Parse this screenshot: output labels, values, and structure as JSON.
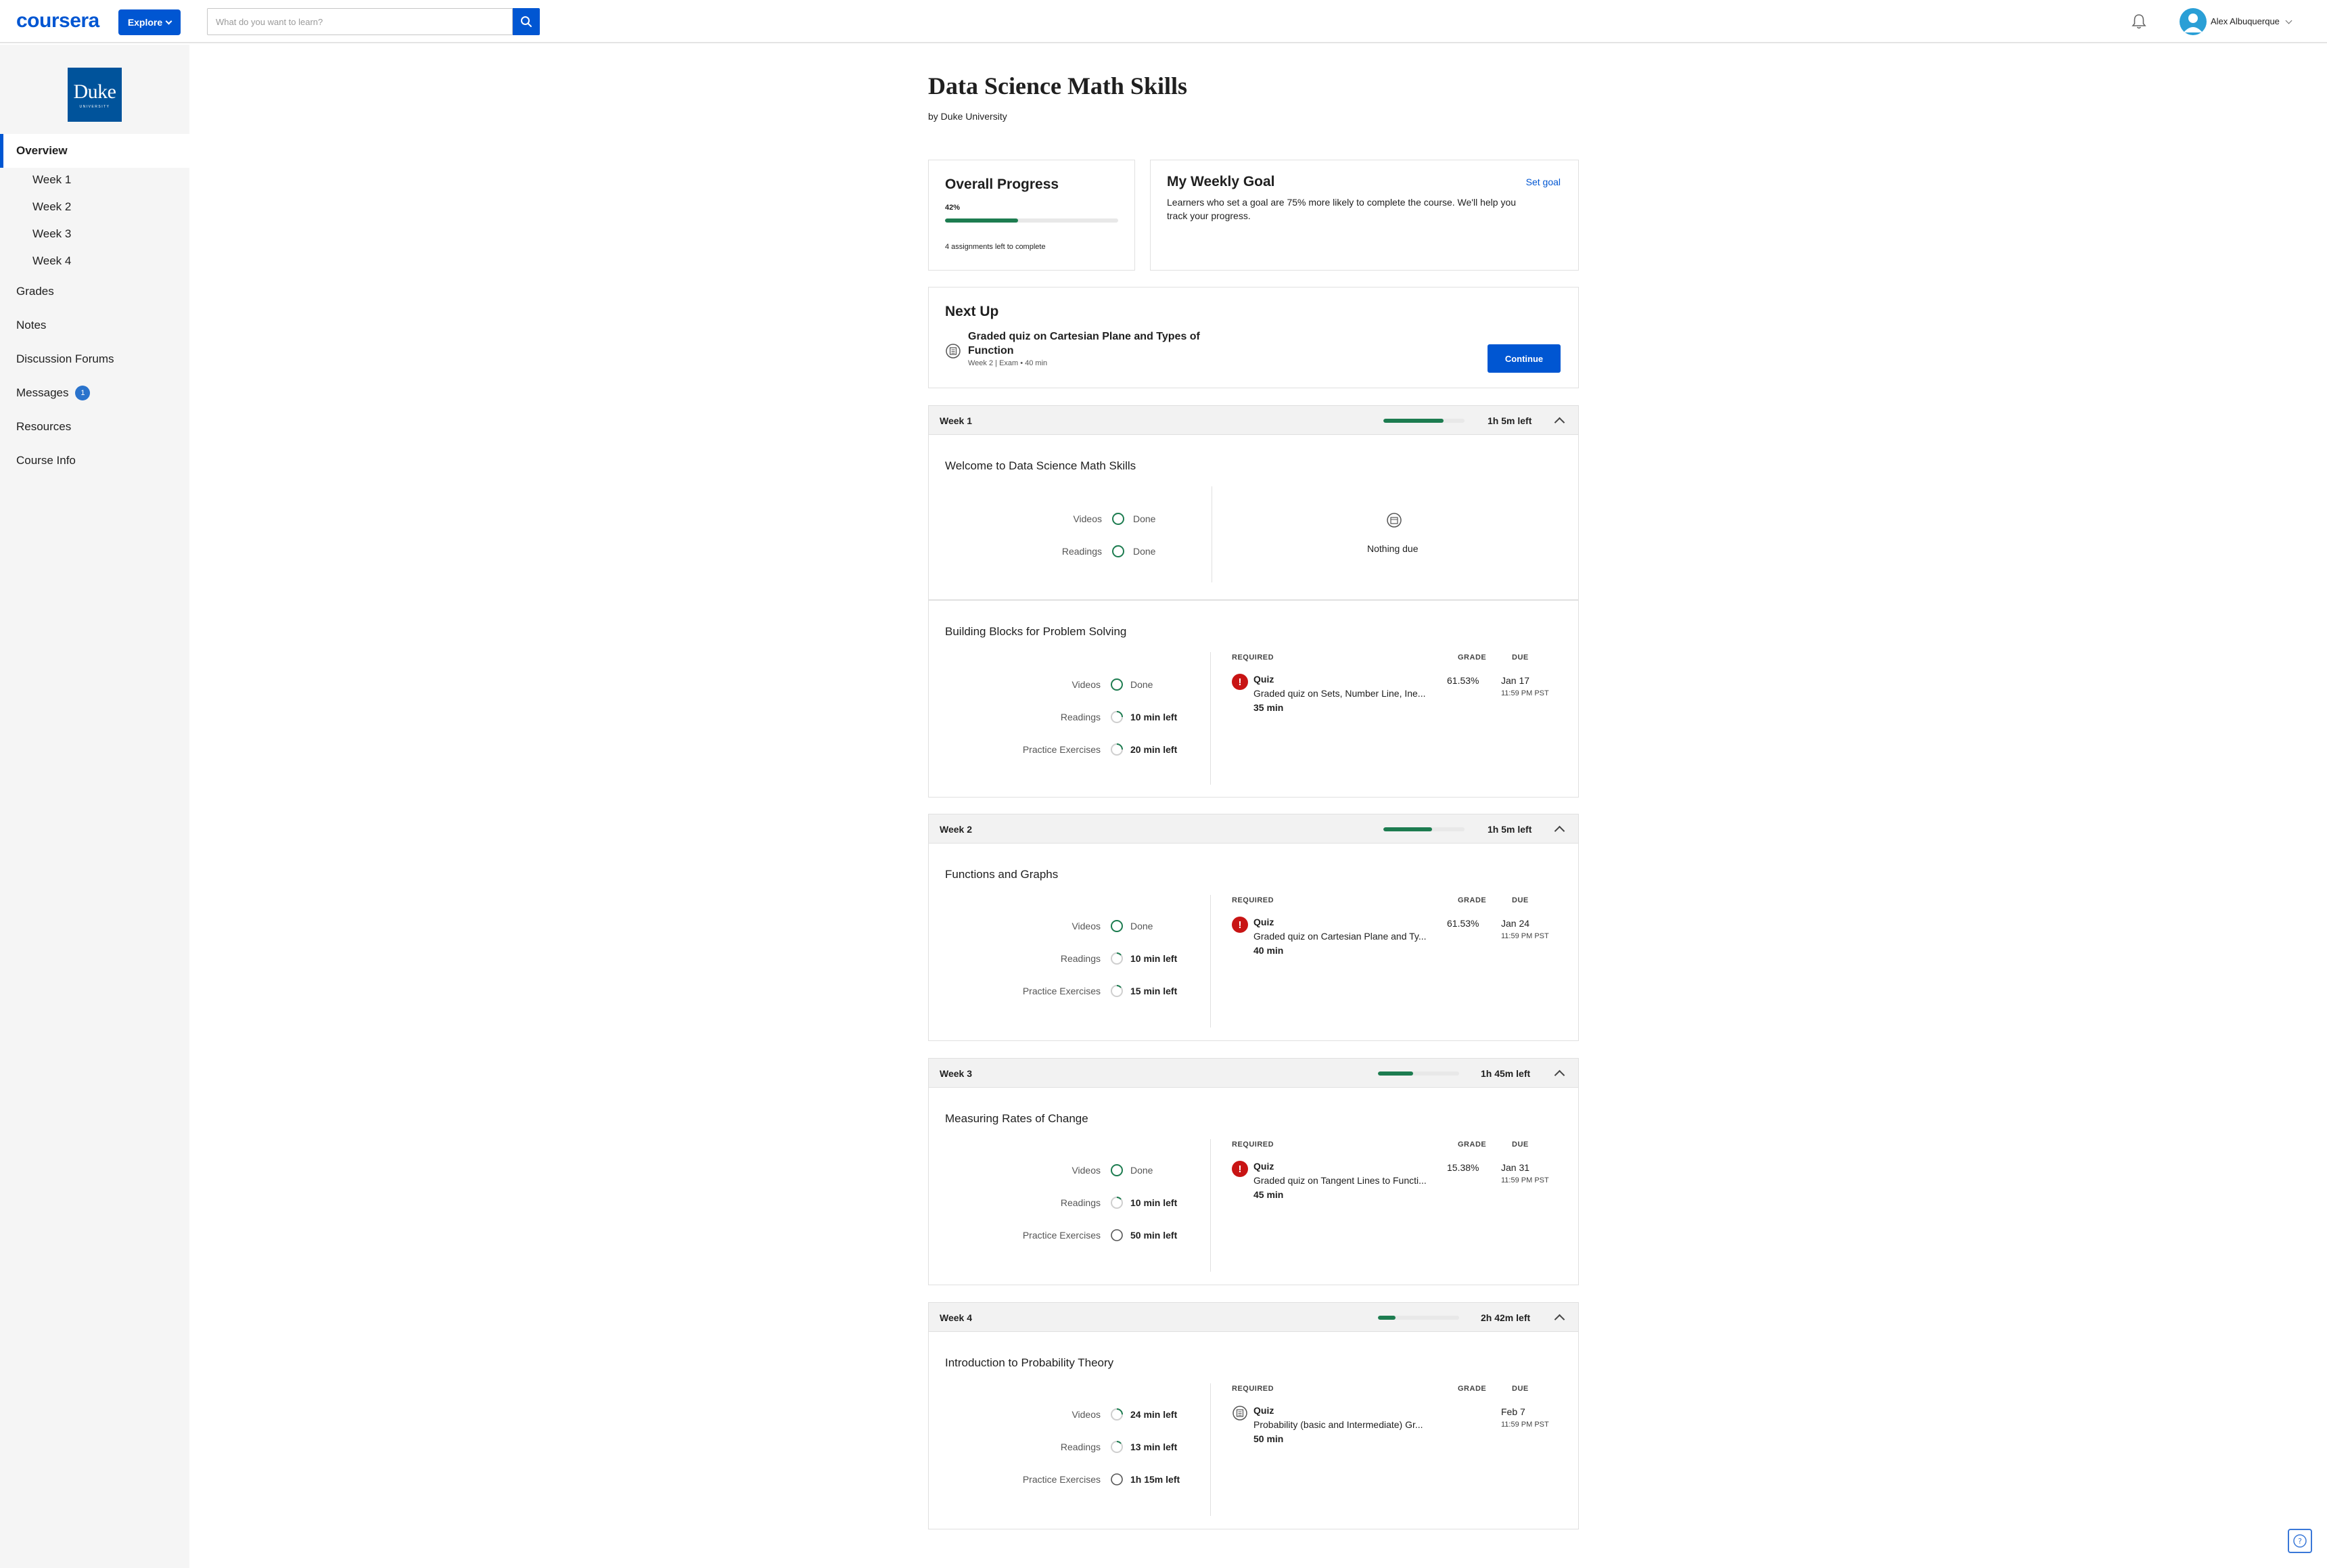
{
  "header": {
    "logo": "coursera",
    "explore_label": "Explore",
    "search_placeholder": "What do you want to learn?",
    "user_name": "Alex Albuquerque"
  },
  "sidebar": {
    "university_logo_text": "Duke",
    "university_logo_sub": "UNIVERSITY",
    "items": [
      {
        "label": "Overview",
        "active": true
      },
      {
        "label": "Week 1"
      },
      {
        "label": "Week 2"
      },
      {
        "label": "Week 3"
      },
      {
        "label": "Week 4"
      },
      {
        "label": "Grades"
      },
      {
        "label": "Notes"
      },
      {
        "label": "Discussion Forums"
      },
      {
        "label": "Messages",
        "badge": "1"
      },
      {
        "label": "Resources"
      },
      {
        "label": "Course Info"
      }
    ]
  },
  "course": {
    "title": "Data Science Math Skills",
    "org": "by Duke University"
  },
  "overall_progress": {
    "title": "Overall Progress",
    "percent_label": "42%",
    "percent": 42,
    "assignments_left": "4 assignments left to complete"
  },
  "weekly_goal": {
    "title": "My Weekly Goal",
    "set_goal": "Set goal",
    "description": "Learners who set a goal are 75% more likely to complete the course. We'll help you track your progress."
  },
  "next_up": {
    "title": "Next Up",
    "item_title": "Graded quiz on Cartesian Plane and Types of Function",
    "item_meta": "Week 2 | Exam • 40 min",
    "continue_label": "Continue"
  },
  "labels": {
    "videos": "Videos",
    "readings": "Readings",
    "practice": "Practice Exercises",
    "done": "Done",
    "required": "REQUIRED",
    "grade": "GRADE",
    "due": "DUE",
    "quiz": "Quiz",
    "nothing_due": "Nothing due"
  },
  "weeks": [
    {
      "title": "Week 1",
      "time_left": "1h 5m left",
      "progress": 74,
      "modules": [
        {
          "title": "Welcome to Data Science Math Skills",
          "videos": "Done",
          "readings": "Done"
        },
        {
          "title": "Building Blocks for Problem Solving",
          "videos": "Done",
          "readings": "10 min left",
          "practice": "20 min left",
          "quiz": {
            "name": "Graded quiz on Sets, Number Line, Ine...",
            "duration": "35 min",
            "grade": "61.53%",
            "due_date": "Jan 17",
            "due_time": "11:59 PM PST"
          }
        }
      ]
    },
    {
      "title": "Week 2",
      "time_left": "1h 5m left",
      "progress": 60,
      "modules": [
        {
          "title": "Functions and Graphs",
          "videos": "Done",
          "readings": "10 min left",
          "practice": "15 min left",
          "quiz": {
            "name": "Graded quiz on Cartesian Plane and Ty...",
            "duration": "40 min",
            "grade": "61.53%",
            "due_date": "Jan 24",
            "due_time": "11:59 PM PST"
          }
        }
      ]
    },
    {
      "title": "Week 3",
      "time_left": "1h 45m left",
      "progress": 43,
      "modules": [
        {
          "title": "Measuring Rates of Change",
          "videos": "Done",
          "readings": "10 min left",
          "practice": "50 min left",
          "quiz": {
            "name": "Graded quiz on Tangent Lines to Functi...",
            "duration": "45 min",
            "grade": "15.38%",
            "due_date": "Jan 31",
            "due_time": "11:59 PM PST"
          }
        }
      ]
    },
    {
      "title": "Week 4",
      "time_left": "2h 42m left",
      "progress": 22,
      "modules": [
        {
          "title": "Introduction to Probability Theory",
          "videos": "24 min left",
          "readings": "13 min left",
          "practice": "1h 15m left",
          "quiz": {
            "name": "Probability (basic and Intermediate) Gr...",
            "duration": "50 min",
            "grade": "",
            "due_date": "Feb 7",
            "due_time": "11:59 PM PST"
          }
        }
      ]
    }
  ],
  "colors": {
    "brand": "#0056d2",
    "progress": "#1d7c50",
    "alert": "#c81414"
  }
}
